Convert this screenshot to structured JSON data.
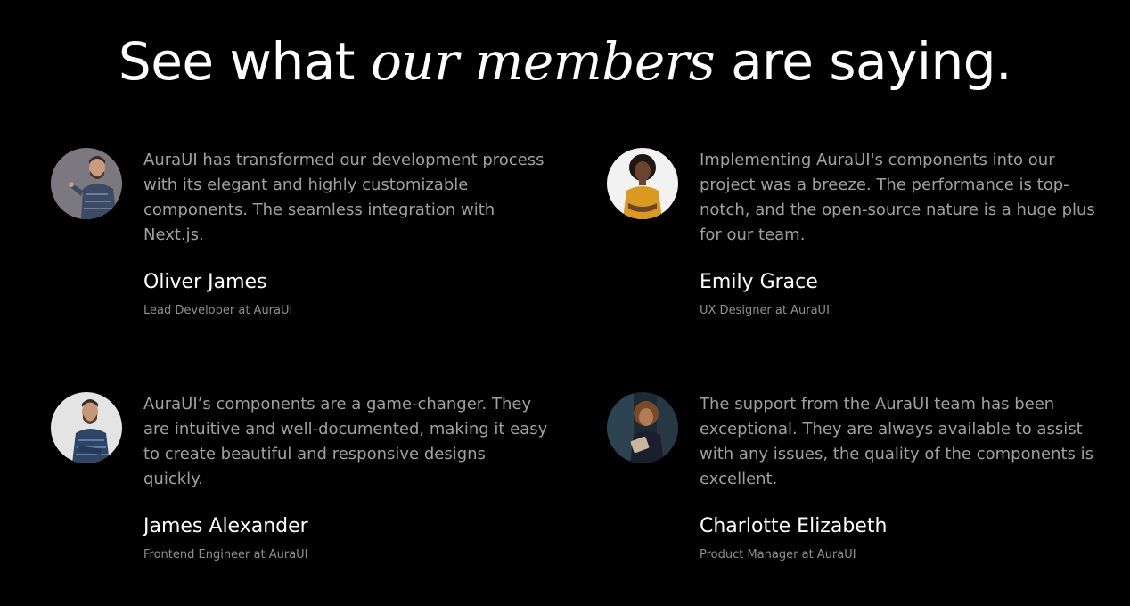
{
  "headline": {
    "prefix": "See what ",
    "emphasis": "our members",
    "suffix": " are saying."
  },
  "testimonials": [
    {
      "quote": "AuraUI has transformed our development process with its elegant and highly customizable components. The seamless integration with Next.js.",
      "name": "Oliver James",
      "role": "Lead Developer at AuraUI"
    },
    {
      "quote": "Implementing AuraUI's components into our project was a breeze. The performance is top-notch, and the open-source nature is a huge plus for our team.",
      "name": "Emily Grace",
      "role": "UX Designer at AuraUI"
    },
    {
      "quote": "AuraUI’s components are a game-changer. They are intuitive and well-documented, making it easy to create beautiful and responsive designs quickly.",
      "name": "James Alexander",
      "role": "Frontend Engineer at AuraUI"
    },
    {
      "quote": "The support from the AuraUI team has been exceptional. They are always available to assist with any issues, the quality of the components is excellent.",
      "name": "Charlotte Elizabeth",
      "role": "Product Manager at AuraUI"
    }
  ],
  "colors": {
    "background": "#000000",
    "heading": "#ffffff",
    "quote_text": "#a0a0a0",
    "role_text": "#8f8f8f"
  },
  "icons": [
    "avatar-photo"
  ]
}
